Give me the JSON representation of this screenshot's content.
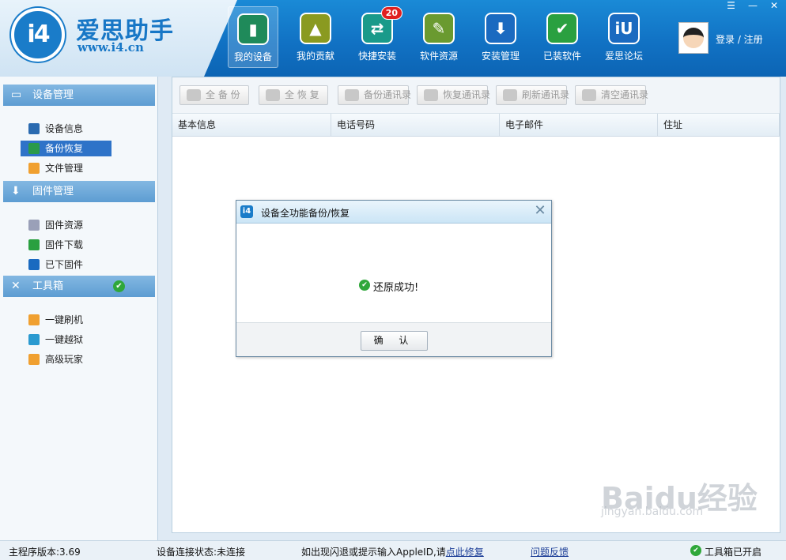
{
  "app": {
    "title": "爱思助手",
    "url": "www.i4.cn",
    "logo_text": "i4"
  },
  "nav": [
    {
      "label": "我的设备",
      "icon": "phone-icon",
      "glyph": "▮",
      "color": "#1f8a5a",
      "active": true
    },
    {
      "label": "我的贡献",
      "icon": "chart-icon",
      "glyph": "▲",
      "color": "#8a9a20"
    },
    {
      "label": "快捷安装",
      "icon": "usb-icon",
      "glyph": "⇄",
      "color": "#1a9a8a",
      "badge": "20"
    },
    {
      "label": "软件资源",
      "icon": "apps-icon",
      "glyph": "✎",
      "color": "#6a9a30"
    },
    {
      "label": "安装管理",
      "icon": "download-icon",
      "glyph": "⬇",
      "color": "#1a6ac0"
    },
    {
      "label": "已装软件",
      "icon": "check-icon",
      "glyph": "✔",
      "color": "#2aa040"
    },
    {
      "label": "爱思论坛",
      "icon": "forum-icon",
      "glyph": "iU",
      "color": "#1a6ac0"
    }
  ],
  "user": {
    "login_text": "登录 / 注册"
  },
  "sidebar": {
    "sections": [
      {
        "label": "设备管理",
        "icon": "monitor-icon",
        "items": [
          {
            "label": "设备信息",
            "icon": "device-info-icon",
            "color": "#2a6ab0"
          },
          {
            "label": "备份恢复",
            "icon": "backup-icon",
            "color": "#2a9a4a",
            "active": true
          },
          {
            "label": "文件管理",
            "icon": "folder-icon",
            "color": "#f0a030"
          }
        ]
      },
      {
        "label": "固件管理",
        "icon": "inbox-icon",
        "items": [
          {
            "label": "固件资源",
            "icon": "firmware-icon",
            "color": "#9aa0b8"
          },
          {
            "label": "固件下载",
            "icon": "firmware-download-icon",
            "color": "#2aa040"
          },
          {
            "label": "已下固件",
            "icon": "ios-icon",
            "color": "#1a6ac0"
          }
        ]
      },
      {
        "label": "工具箱",
        "icon": "tools-icon",
        "checked": true,
        "items": [
          {
            "label": "一键刷机",
            "icon": "flash-icon",
            "color": "#f0a030"
          },
          {
            "label": "一键越狱",
            "icon": "jailbreak-icon",
            "color": "#2a9ad0"
          },
          {
            "label": "高级玩家",
            "icon": "folder-icon",
            "color": "#f0a030"
          }
        ]
      }
    ]
  },
  "toolbar": {
    "buttons": [
      {
        "label": "全 备 份",
        "icon": "backup-all-icon"
      },
      {
        "label": "全 恢 复",
        "icon": "restore-all-icon"
      },
      {
        "label": "备份通讯录",
        "icon": "backup-contacts-icon"
      },
      {
        "label": "恢复通讯录",
        "icon": "restore-contacts-icon"
      },
      {
        "label": "刷新通讯录",
        "icon": "refresh-contacts-icon"
      },
      {
        "label": "清空通讯录",
        "icon": "clear-contacts-icon"
      }
    ]
  },
  "table": {
    "columns": [
      "基本信息",
      "电话号码",
      "电子邮件",
      "住址"
    ]
  },
  "dialog": {
    "title": "设备全功能备份/恢复",
    "message": "还原成功!",
    "ok_label": "确 认"
  },
  "status": {
    "version": "主程序版本:3.69",
    "connection": "设备连接状态:未连接",
    "hint": "如出现闪退或提示输入AppleID,请",
    "hint_link": "点此修复",
    "feedback": "问题反馈",
    "toolbox": "工具箱已开启"
  },
  "watermark": {
    "text": "Baidu经验",
    "sub": "jingyan.baidu.com"
  },
  "colors": {
    "header": "#1172c4",
    "accent": "#2e73c8",
    "success": "#2fa73a"
  }
}
